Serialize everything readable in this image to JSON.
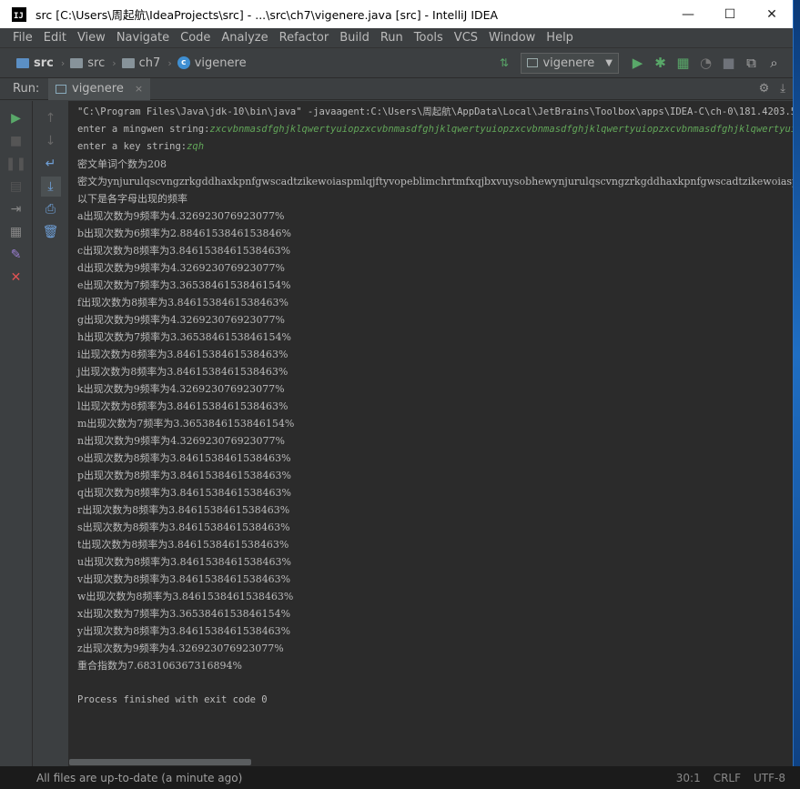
{
  "window": {
    "title": "src [C:\\Users\\周起航\\IdeaProjects\\src] - ...\\src\\ch7\\vigenere.java [src] - IntelliJ IDEA",
    "logo_text": "IJ",
    "minimize": "—",
    "maximize": "☐",
    "close": "✕"
  },
  "menu": [
    "File",
    "Edit",
    "View",
    "Navigate",
    "Code",
    "Analyze",
    "Refactor",
    "Build",
    "Run",
    "Tools",
    "VCS",
    "Window",
    "Help"
  ],
  "breadcrumb": [
    "src",
    "src",
    "ch7",
    "vigenere"
  ],
  "toolbar": {
    "run_config": "vigenere",
    "colors": {
      "run": "#59a869",
      "debug": "#59a869",
      "stop": "#6f737a"
    }
  },
  "run_panel": {
    "label": "Run:",
    "tab_label": "vigenere",
    "close": "×"
  },
  "console": {
    "command": "\"C:\\Program Files\\Java\\jdk-10\\bin\\java\" -javaagent:C:\\Users\\周起航\\AppData\\Local\\JetBrains\\Toolbox\\apps\\IDEA-C\\ch-0\\181.4203.550\\li",
    "prompt_plaintext": "enter a mingwen string:",
    "input_plaintext": "zxcvbnmasdfghjklqwertyuiopzxcvbnmasdfghjklqwertyuiopzxcvbnmasdfghjklqwertyuiopzxcvbnmasdfghjklqwertyuiopzxcv",
    "prompt_key": "enter a key string:",
    "input_key": "zqh",
    "word_count": "密文单词个数为208",
    "ciphertext": "密文为ynjurulqscvngzrkgddhaxkpnfgwscadtzikewoiaspmlqjftyvopeblimchrtmfxqjbxvuysobhewynjurulqscvngzrkgddhaxkpnfgwscadtzikewoiaspmlqj",
    "freq_header": "以下是各字母出现的频率",
    "frequencies": [
      "a出现次数为9频率为4.326923076923077%",
      "b出现次数为6频率为2.8846153846153846%",
      "c出现次数为8频率为3.8461538461538463%",
      "d出现次数为9频率为4.326923076923077%",
      "e出现次数为7频率为3.3653846153846154%",
      "f出现次数为8频率为3.8461538461538463%",
      "g出现次数为9频率为4.326923076923077%",
      "h出现次数为7频率为3.3653846153846154%",
      "i出现次数为8频率为3.8461538461538463%",
      "j出现次数为8频率为3.8461538461538463%",
      "k出现次数为9频率为4.326923076923077%",
      "l出现次数为8频率为3.8461538461538463%",
      "m出现次数为7频率为3.3653846153846154%",
      "n出现次数为9频率为4.326923076923077%",
      "o出现次数为8频率为3.8461538461538463%",
      "p出现次数为8频率为3.8461538461538463%",
      "q出现次数为8频率为3.8461538461538463%",
      "r出现次数为8频率为3.8461538461538463%",
      "s出现次数为8频率为3.8461538461538463%",
      "t出现次数为8频率为3.8461538461538463%",
      "u出现次数为8频率为3.8461538461538463%",
      "v出现次数为8频率为3.8461538461538463%",
      "w出现次数为8频率为3.8461538461538463%",
      "x出现次数为7频率为3.3653846153846154%",
      "y出现次数为8频率为3.8461538461538463%",
      "z出现次数为9频率为4.326923076923077%"
    ],
    "coincidence_index": "重合指数为7.683106367316894%",
    "exit_message": "Process finished with exit code 0"
  },
  "statusbar": {
    "message": "All files are up-to-date (a minute ago)",
    "position": "30:1",
    "line_sep": "CRLF",
    "encoding": "UTF-8"
  }
}
